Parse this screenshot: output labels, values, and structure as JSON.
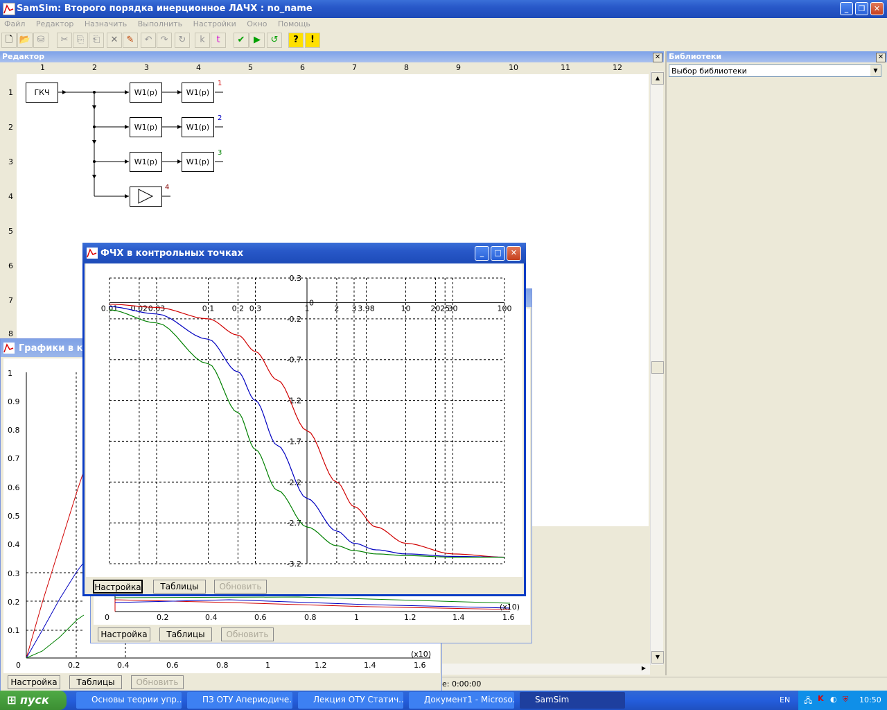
{
  "app": {
    "title": "SamSim: Второго порядка инерционное ЛАЧХ : no_name",
    "menu": [
      "Файл",
      "Редактор",
      "Назначить",
      "Выполнить",
      "Настройки",
      "Окно",
      "Помощь"
    ]
  },
  "editor": {
    "title": "Редактор",
    "columns": [
      "1",
      "2",
      "3",
      "4",
      "5",
      "6",
      "7",
      "8",
      "9",
      "10",
      "11",
      "12"
    ],
    "rows": [
      "1",
      "2",
      "3",
      "4",
      "5",
      "6",
      "7",
      "8"
    ],
    "generator_label": "ГКЧ",
    "block_label": "W1(p)",
    "outputs": [
      "1",
      "2",
      "3",
      "4"
    ],
    "colors": {
      "out1": "#d00000",
      "out2": "#0000c0",
      "out3": "#008000",
      "out4": "#800000"
    }
  },
  "libraries": {
    "title": "Библиотеки",
    "select_value": "Выбор библиотеки"
  },
  "graph_back": {
    "title": "Графики в кон",
    "y_ticks": [
      "1",
      "0.9",
      "0.8",
      "0.7",
      "0.6",
      "0.5",
      "0.4",
      "0.3",
      "0.2",
      "0.1"
    ],
    "x_ticks": [
      "0",
      "0.2",
      "0.4",
      "0.6",
      "0.8",
      "1",
      "1.2",
      "1.4",
      "1.6"
    ],
    "x_mult": "(x10)",
    "buttons": {
      "settings": "Настройка",
      "tables": "Таблицы",
      "refresh": "Обновить"
    }
  },
  "graph_mid": {
    "x_ticks": [
      "0",
      "0.2",
      "0.4",
      "0.6",
      "0.8",
      "1",
      "1.2",
      "1.4",
      "1.6"
    ],
    "x_mult": "(x10)",
    "buttons": {
      "settings": "Настройка",
      "tables": "Таблицы",
      "refresh": "Обновить"
    }
  },
  "phase_window": {
    "title": "ФЧХ в контрольных точках",
    "buttons": {
      "settings": "Настройка",
      "tables": "Таблицы",
      "refresh": "Обновить"
    },
    "chart_data": {
      "type": "line",
      "title": "ФЧХ в контрольных точках",
      "x_scale": "log",
      "xlim": [
        0.01,
        100
      ],
      "ylim": [
        -3.2,
        0.3
      ],
      "x_tick_labels": [
        "0.01",
        "0.02",
        "0.03",
        "0.1",
        "0.2",
        "0.3",
        "1",
        "2",
        "3",
        "3.98",
        "10",
        "20",
        "25",
        "30",
        "100"
      ],
      "x_tick_values": [
        0.01,
        0.02,
        0.03,
        0.1,
        0.2,
        0.3,
        1,
        2,
        3,
        3.98,
        10,
        20,
        25,
        30,
        100
      ],
      "y_tick_labels": [
        "0.3",
        "-0.2",
        "-0.7",
        "-1.2",
        "-1.7",
        "-2.2",
        "-2.7",
        "-3.2"
      ],
      "y_tick_values": [
        0.3,
        -0.2,
        -0.7,
        -1.2,
        -1.7,
        -2.2,
        -2.7,
        -3.2
      ],
      "zero_label": "0",
      "grid": true,
      "series": [
        {
          "color": "#d00000",
          "x": [
            0.01,
            0.03,
            0.1,
            0.2,
            0.3,
            0.5,
            1,
            2,
            3,
            5,
            10,
            30,
            100
          ],
          "y": [
            -0.02,
            -0.06,
            -0.2,
            -0.4,
            -0.6,
            -0.95,
            -1.57,
            -2.2,
            -2.5,
            -2.75,
            -2.95,
            -3.08,
            -3.12
          ]
        },
        {
          "color": "#0000c0",
          "x": [
            0.01,
            0.03,
            0.1,
            0.2,
            0.3,
            0.5,
            1,
            2,
            3,
            5,
            10,
            30,
            100
          ],
          "y": [
            -0.05,
            -0.14,
            -0.45,
            -0.85,
            -1.2,
            -1.75,
            -2.4,
            -2.8,
            -2.95,
            -3.03,
            -3.08,
            -3.11,
            -3.12
          ]
        },
        {
          "color": "#008000",
          "x": [
            0.01,
            0.03,
            0.1,
            0.2,
            0.3,
            0.5,
            1,
            2,
            3,
            5,
            10,
            30,
            100
          ],
          "y": [
            -0.09,
            -0.25,
            -0.75,
            -1.35,
            -1.8,
            -2.3,
            -2.75,
            -2.98,
            -3.04,
            -3.08,
            -3.1,
            -3.12,
            -3.12
          ]
        }
      ]
    }
  },
  "status": {
    "time": "e: 0:00:00"
  },
  "taskbar": {
    "start": "пуск",
    "tasks": [
      "Основы теории упр...",
      "ПЗ ОТУ Апериодиче...",
      "Лекция ОТУ Статич...",
      "Документ1 - Microso...",
      "SamSim"
    ],
    "lang": "EN",
    "clock": "10:50"
  }
}
